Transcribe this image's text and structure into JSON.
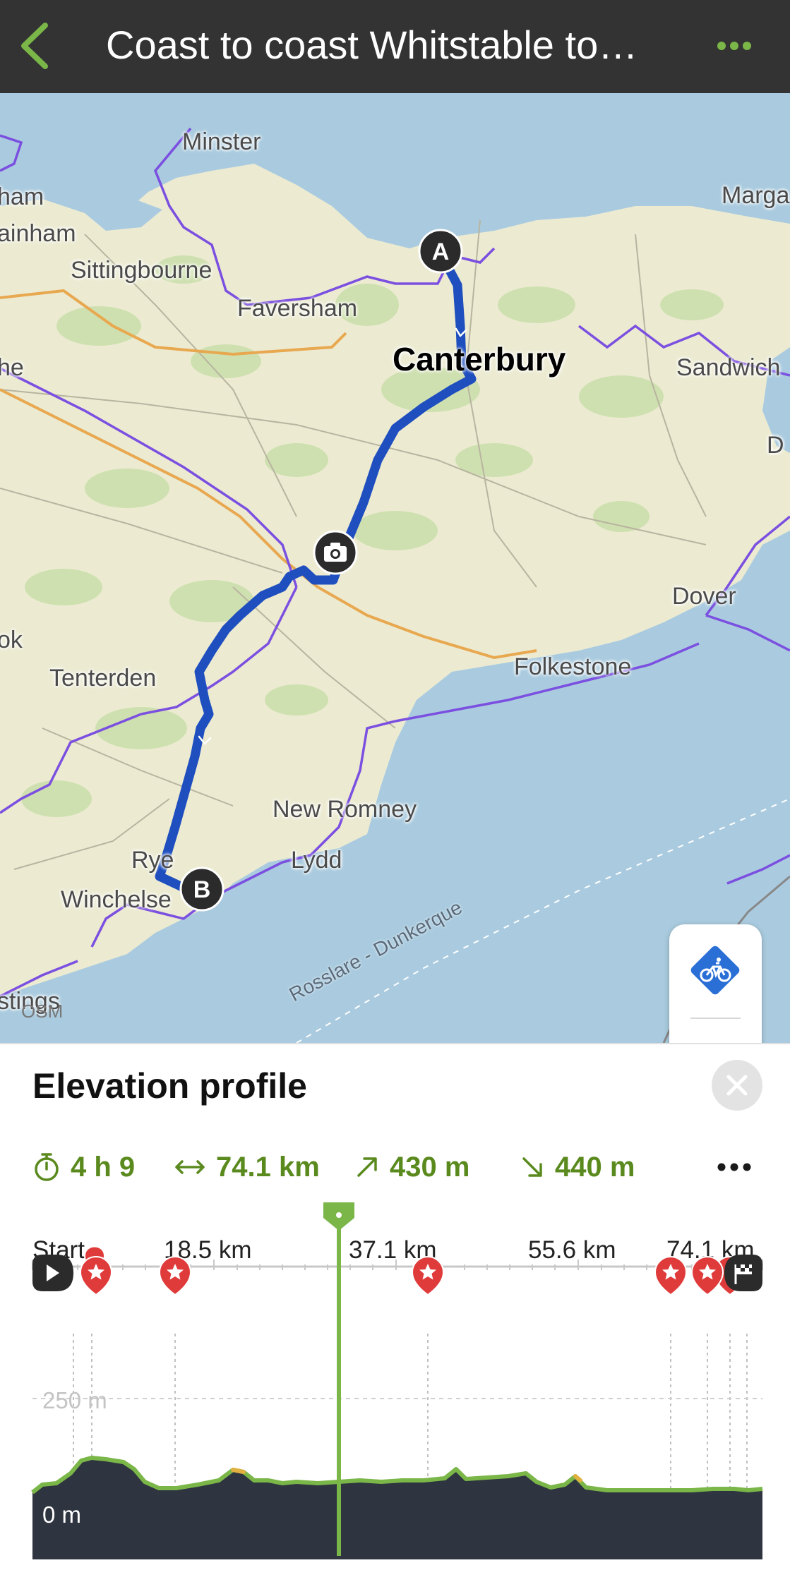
{
  "header": {
    "title": "Coast to coast Whitstable to…",
    "back_icon": "chevron-left-icon",
    "more_icon": "more-horizontal-icon"
  },
  "map": {
    "labels": [
      {
        "name": "minster",
        "text": "Minster"
      },
      {
        "name": "ham",
        "text": "ham"
      },
      {
        "name": "margate",
        "text": "Marga"
      },
      {
        "name": "rainham",
        "text": "ainham"
      },
      {
        "name": "sittingbourne",
        "text": "Sittingbourne"
      },
      {
        "name": "faversham",
        "text": "Faversham"
      },
      {
        "name": "canterbury",
        "text": "Canterbury"
      },
      {
        "name": "sandwich",
        "text": "Sandwich"
      },
      {
        "name": "he",
        "text": "he"
      },
      {
        "name": "d",
        "text": "D"
      },
      {
        "name": "dover",
        "text": "Dover"
      },
      {
        "name": "ok",
        "text": "ok"
      },
      {
        "name": "folkestone",
        "text": "Folkestone"
      },
      {
        "name": "tenterden",
        "text": "Tenterden"
      },
      {
        "name": "new-romney",
        "text": "New Romney"
      },
      {
        "name": "lydd",
        "text": "Lydd"
      },
      {
        "name": "rye",
        "text": "Rye"
      },
      {
        "name": "winchelsea",
        "text": "Winchelse"
      },
      {
        "name": "hastings",
        "text": "stings"
      }
    ],
    "ferry_label": "Rosslare - Dunkerque",
    "attribution": "OSM",
    "start_marker": "A",
    "end_marker": "B",
    "controls": {
      "bike_icon": "bicycle-icon",
      "locate_icon": "navigation-arrow-icon"
    },
    "colors": {
      "sea": "#aacbdf",
      "land": "#ecebd2",
      "route": "#1f4fbf",
      "boundary": "#7b4fe0",
      "road": "#e8a850"
    }
  },
  "elevation": {
    "title": "Elevation profile",
    "close_icon": "close-icon",
    "stats": {
      "duration": "4 h 9",
      "distance": "74.1 km",
      "ascent": "430 m",
      "descent": "440 m"
    },
    "stat_icons": [
      "stopwatch-icon",
      "distance-arrows-icon",
      "ascent-arrow-icon",
      "descent-arrow-icon"
    ],
    "more_icon": "more-horizontal-icon",
    "axis_labels": [
      "Start",
      "18.5 km",
      "37.1 km",
      "55.6 km",
      "74.1 km"
    ],
    "y_labels": [
      "250 m",
      "0 m"
    ],
    "accent": "#7ab648",
    "fill": "#2e3440"
  }
}
